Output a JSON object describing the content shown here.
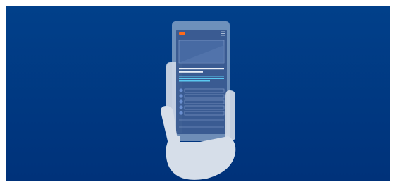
{
  "scene": {
    "description_icon": "hand-holding-phone-icon",
    "colors": {
      "background_top": "#01408a",
      "background_bottom": "#00327a",
      "hand": "#d6dee9",
      "phone_frame": "#c9d5e6",
      "phone_screen": "#37588f",
      "accent": "#ff6a1a",
      "highlight_line": "#5ac8f0",
      "text_line": "#e8eef7",
      "list_bullet": "#6b8fd0"
    }
  }
}
